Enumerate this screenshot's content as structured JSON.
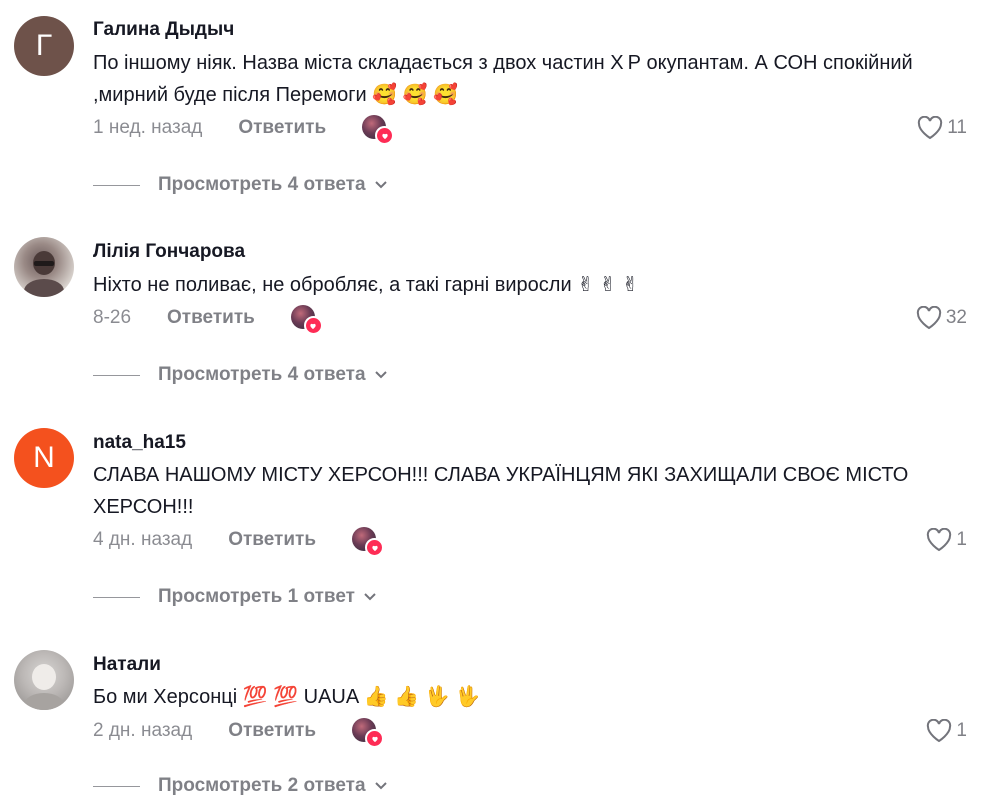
{
  "comments": [
    {
      "author": "Галина Дыдыч",
      "avatar_letter": "Г",
      "text_line1": "По іншому ніяк. Назва міста складається з двох частин Х Р окупантам. А СОН спокійний",
      "text_line2": ",мирний буде після Перемоги 🥰 🥰 🥰",
      "date": "1 нед. назад",
      "reply_label": "Ответить",
      "likes": "11",
      "view_replies": "Просмотреть 4 ответа"
    },
    {
      "author": "Лілія Гончарова",
      "text_line1": "Ніхто не поливає, не обробляє, а такі гарні виросли ✌ ✌ ✌",
      "date": "8-26",
      "reply_label": "Ответить",
      "likes": "32",
      "view_replies": "Просмотреть 4 ответа"
    },
    {
      "author": "nata_ha15",
      "avatar_letter": "N",
      "text_line1": "СЛАВА НАШОМУ МІСТУ ХЕРСОН!!! СЛАВА УКРАЇНЦЯМ ЯКІ ЗАХИЩАЛИ СВОЄ МІСТО",
      "text_line2": "ХЕРСОН!!!",
      "date": "4 дн. назад",
      "reply_label": "Ответить",
      "likes": "1",
      "view_replies": "Просмотреть 1 ответ"
    },
    {
      "author": "Натали",
      "text_line1": "Бо ми Херсонці 💯 💯 UAUA 👍 👍 🖖 🖖",
      "date": "2 дн. назад",
      "reply_label": "Ответить",
      "likes": "1",
      "view_replies": "Просмотреть 2 ответа"
    }
  ],
  "colors": {
    "avatar_galina": "#6e524a",
    "avatar_nata": "#f4511e",
    "like_badge": "#fe2c55"
  },
  "icons": {
    "like": "heart-outline-icon",
    "expand": "chevron-down-icon",
    "creator_like": "creator-liked-badge-icon"
  }
}
